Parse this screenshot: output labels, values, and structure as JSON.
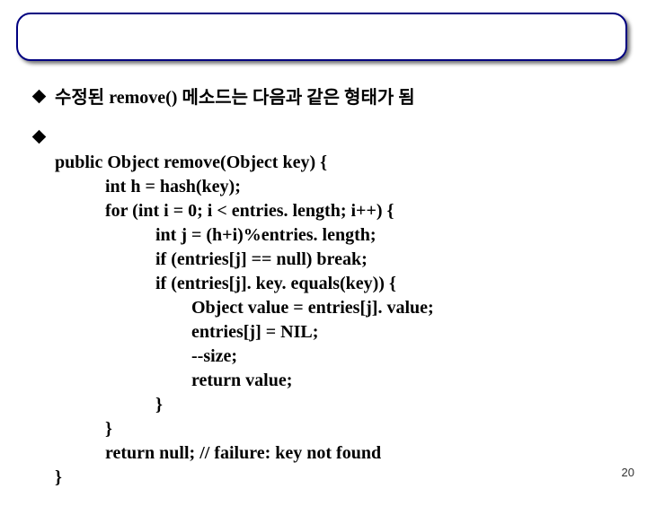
{
  "bullet1": {
    "text": "수정된 remove() 메소드는 다음과 같은 형태가 됨"
  },
  "bullet2": {
    "code": {
      "l1": "public Object remove(Object key) {",
      "l2": "int h = hash(key);",
      "l3": "for (int i = 0; i < entries. length; i++) {",
      "l4": "int j = (h+i)%entries. length;",
      "l5": "if (entries[j] == null) break;",
      "l6": "if (entries[j]. key. equals(key)) {",
      "l7": "Object value = entries[j]. value;",
      "l8": "entries[j] = NIL;",
      "l9": "--size;",
      "l10": "return value;",
      "l11": "}",
      "l12": "}",
      "l13": "return null; // failure: key not found",
      "l14": "}"
    }
  },
  "page_number": "20"
}
